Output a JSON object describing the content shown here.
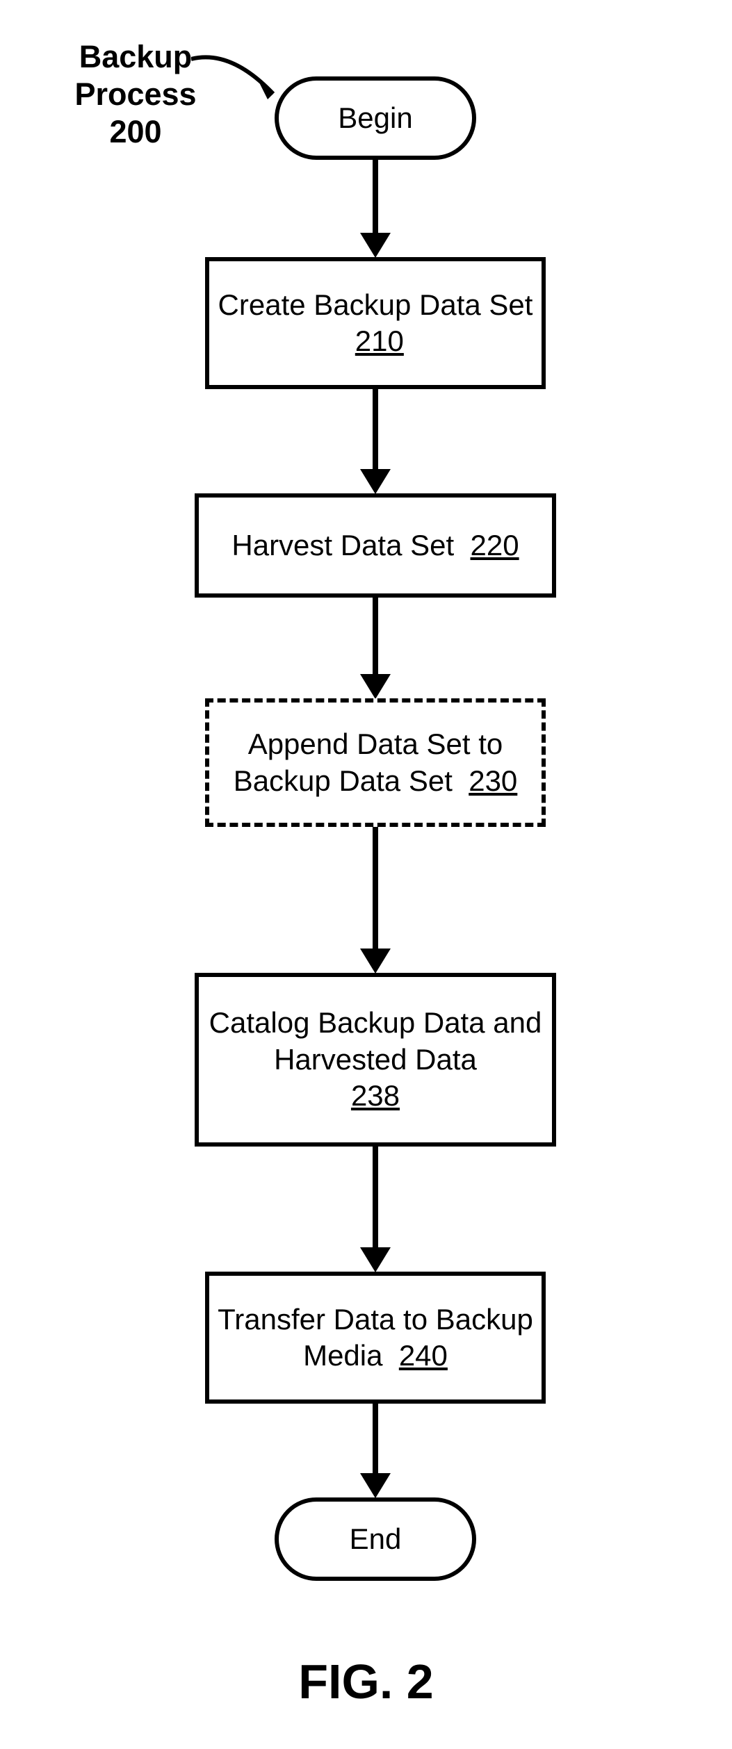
{
  "title_label": "Backup\nProcess 200",
  "nodes": {
    "begin": "Begin",
    "end": "End",
    "step210": {
      "text": "Create Backup Data Set",
      "ref": "210"
    },
    "step220": {
      "text": "Harvest Data Set",
      "ref": "220"
    },
    "step230": {
      "text": "Append Data Set to Backup Data Set",
      "ref": "230"
    },
    "step238": {
      "text": "Catalog Backup Data and Harvested Data",
      "ref": "238"
    },
    "step240": {
      "text": "Transfer Data to Backup Media",
      "ref": "240"
    }
  },
  "figure_caption": "FIG. 2",
  "chart_data": {
    "type": "flowchart",
    "title": "Backup Process 200",
    "nodes": [
      {
        "id": "begin",
        "label": "Begin",
        "shape": "terminator"
      },
      {
        "id": "210",
        "label": "Create Backup Data Set 210",
        "shape": "process"
      },
      {
        "id": "220",
        "label": "Harvest Data Set 220",
        "shape": "process"
      },
      {
        "id": "230",
        "label": "Append Data Set to Backup Data Set 230",
        "shape": "process",
        "optional": true
      },
      {
        "id": "238",
        "label": "Catalog Backup Data and Harvested Data 238",
        "shape": "process"
      },
      {
        "id": "240",
        "label": "Transfer Data to Backup Media 240",
        "shape": "process"
      },
      {
        "id": "end",
        "label": "End",
        "shape": "terminator"
      }
    ],
    "edges": [
      {
        "from": "begin",
        "to": "210"
      },
      {
        "from": "210",
        "to": "220"
      },
      {
        "from": "220",
        "to": "230"
      },
      {
        "from": "230",
        "to": "238"
      },
      {
        "from": "238",
        "to": "240"
      },
      {
        "from": "240",
        "to": "end"
      }
    ]
  }
}
